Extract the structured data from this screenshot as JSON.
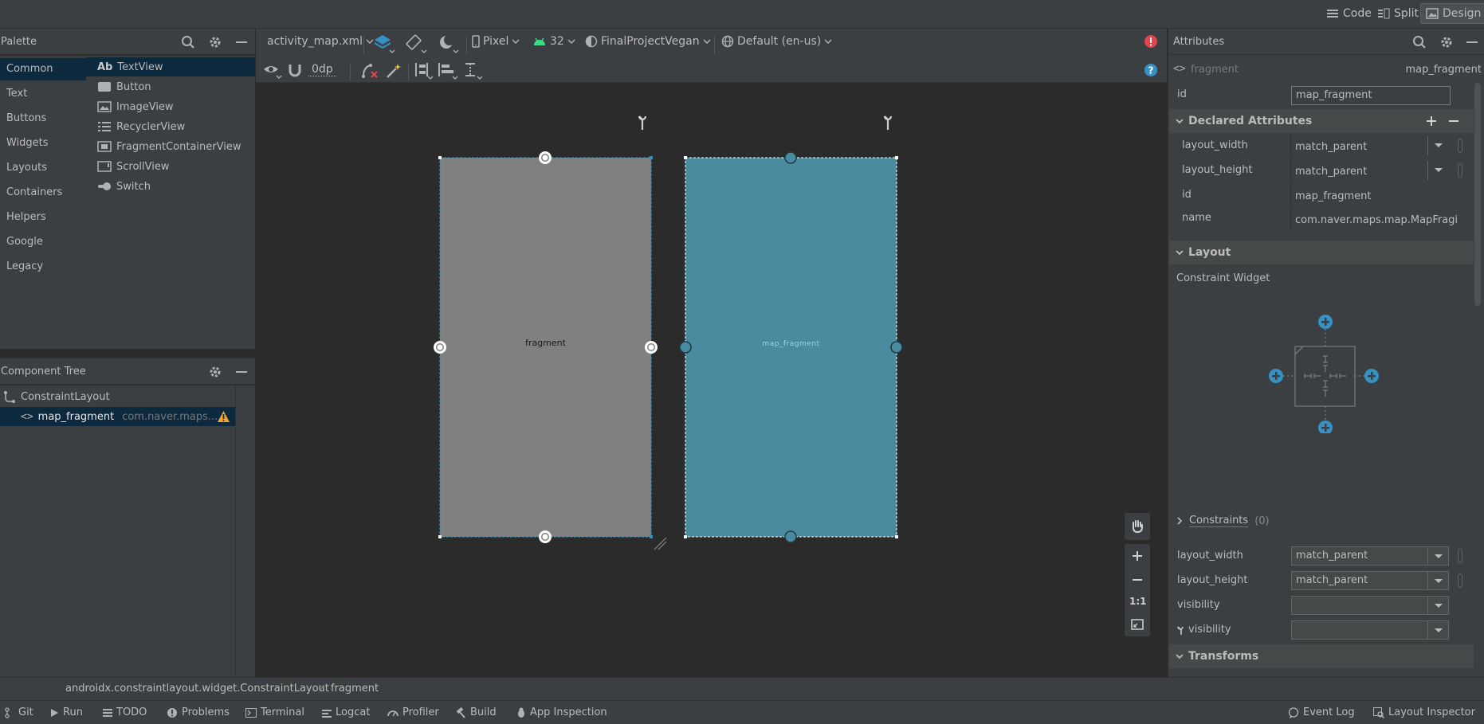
{
  "view_modes": {
    "code": "Code",
    "split": "Split",
    "design": "Design"
  },
  "palette": {
    "title": "Palette",
    "categories": [
      "Common",
      "Text",
      "Buttons",
      "Widgets",
      "Layouts",
      "Containers",
      "Helpers",
      "Google",
      "Legacy"
    ],
    "items": [
      {
        "prefix": "Ab",
        "label": "TextView"
      },
      {
        "label": "Button"
      },
      {
        "label": "ImageView"
      },
      {
        "label": "RecyclerView"
      },
      {
        "label": "FragmentContainerView"
      },
      {
        "label": "ScrollView"
      },
      {
        "label": "Switch"
      }
    ]
  },
  "component_tree": {
    "title": "Component Tree",
    "root": "ConstraintLayout",
    "child_name": "map_fragment",
    "child_class": "com.naver.maps...."
  },
  "toolbar": {
    "file": "activity_map.xml",
    "device": "Pixel",
    "api": "32",
    "theme": "FinalProjectVegan",
    "locale": "Default (en-us)",
    "margin": "0dp"
  },
  "canvas": {
    "design_label": "fragment",
    "blueprint_label": "map_fragment",
    "zoom_reset": "1:1"
  },
  "attributes": {
    "title": "Attributes",
    "element_tag": "fragment",
    "element_id": "map_fragment",
    "id_label": "id",
    "id_value": "map_fragment",
    "declared_title": "Declared Attributes",
    "declared": [
      {
        "name": "layout_width",
        "value": "match_parent"
      },
      {
        "name": "layout_height",
        "value": "match_parent"
      },
      {
        "name": "id",
        "value": "map_fragment"
      },
      {
        "name": "name",
        "value": "com.naver.maps.map.MapFragi"
      }
    ],
    "layout_title": "Layout",
    "constraint_widget": "Constraint Widget",
    "constraints_label": "Constraints",
    "constraints_count": "(0)",
    "layout_fields": [
      {
        "name": "layout_width",
        "value": "match_parent"
      },
      {
        "name": "layout_height",
        "value": "match_parent"
      },
      {
        "name": "visibility",
        "value": ""
      },
      {
        "name": "visibility",
        "value": ""
      }
    ],
    "transforms_title": "Transforms"
  },
  "breadcrumb": {
    "parent": "androidx.constraintlayout.widget.ConstraintLayout",
    "current": "fragment"
  },
  "status_bar": {
    "left": [
      "Git",
      "Run",
      "TODO",
      "Problems",
      "Terminal",
      "Logcat",
      "Profiler",
      "Build",
      "App Inspection"
    ],
    "right": [
      "Event Log",
      "Layout Inspector"
    ]
  },
  "colors": {
    "accent": "#3592c4",
    "selection": "#0d293e",
    "blueprint": "#4a8ba0",
    "design_surface": "#808080",
    "error": "#e0474c",
    "warning": "#f0a732"
  }
}
